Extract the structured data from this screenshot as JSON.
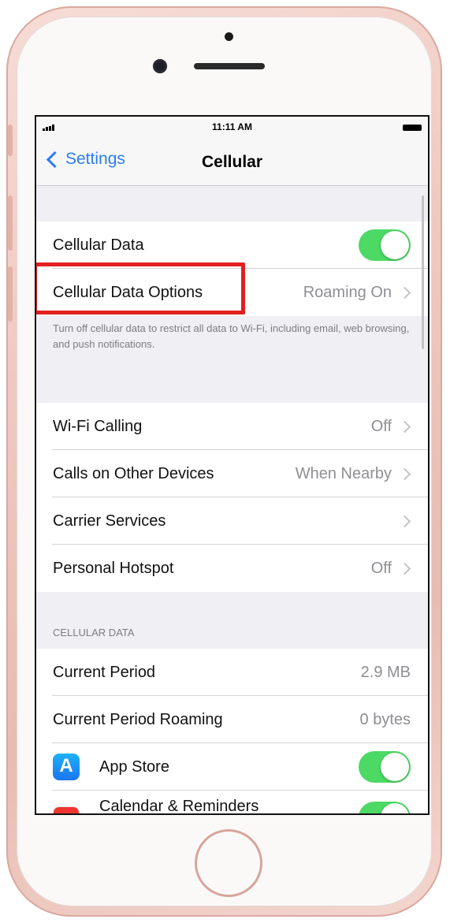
{
  "status_bar": {
    "time": "11:11 AM"
  },
  "nav": {
    "back_label": "Settings",
    "title": "Cellular"
  },
  "group1": {
    "cellular_data": {
      "label": "Cellular Data",
      "toggle_on": true
    },
    "cellular_data_options": {
      "label": "Cellular Data Options",
      "value": "Roaming On"
    },
    "footer": "Turn off cellular data to restrict all data to Wi-Fi, including email, web browsing, and push notifications."
  },
  "group2": {
    "items": [
      {
        "label": "Wi-Fi Calling",
        "value": "Off"
      },
      {
        "label": "Calls on Other Devices",
        "value": "When Nearby"
      },
      {
        "label": "Carrier Services",
        "value": ""
      },
      {
        "label": "Personal Hotspot",
        "value": "Off"
      }
    ]
  },
  "cellular_section": {
    "header": "CELLULAR DATA",
    "current_period": {
      "label": "Current Period",
      "value": "2.9 MB"
    },
    "current_period_roaming": {
      "label": "Current Period Roaming",
      "value": "0 bytes"
    },
    "apps": [
      {
        "label": "App Store",
        "icon": "app-store-icon",
        "toggle_on": true
      },
      {
        "label": "Calendar & Reminders",
        "icon": "calendar-icon",
        "toggle_on": true
      }
    ]
  },
  "colors": {
    "accent": "#2d7cf6",
    "toggle_on": "#4cd964",
    "highlight": "#e32020",
    "phone_body": "#efc9c0"
  }
}
